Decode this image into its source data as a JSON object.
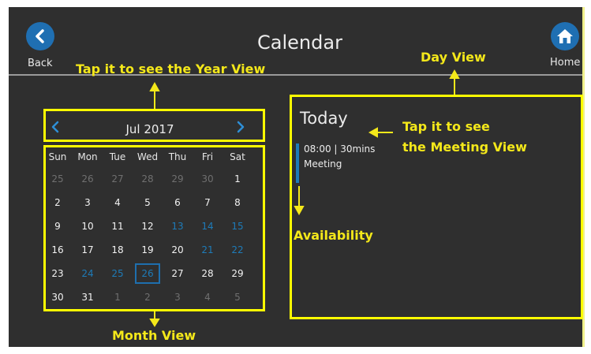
{
  "header": {
    "title": "Calendar",
    "back_label": "Back",
    "home_label": "Home"
  },
  "month_view": {
    "month_label": "Jul 2017",
    "weekdays": [
      "Sun",
      "Mon",
      "Tue",
      "Wed",
      "Thu",
      "Fri",
      "Sat"
    ],
    "weeks": [
      [
        {
          "d": "25",
          "s": "other"
        },
        {
          "d": "26",
          "s": "other"
        },
        {
          "d": "27",
          "s": "other"
        },
        {
          "d": "28",
          "s": "other"
        },
        {
          "d": "29",
          "s": "other"
        },
        {
          "d": "30",
          "s": "other"
        },
        {
          "d": "1",
          "s": ""
        }
      ],
      [
        {
          "d": "2",
          "s": ""
        },
        {
          "d": "3",
          "s": ""
        },
        {
          "d": "4",
          "s": ""
        },
        {
          "d": "5",
          "s": ""
        },
        {
          "d": "6",
          "s": ""
        },
        {
          "d": "7",
          "s": ""
        },
        {
          "d": "8",
          "s": ""
        }
      ],
      [
        {
          "d": "9",
          "s": ""
        },
        {
          "d": "10",
          "s": ""
        },
        {
          "d": "11",
          "s": ""
        },
        {
          "d": "12",
          "s": ""
        },
        {
          "d": "13",
          "s": "blue"
        },
        {
          "d": "14",
          "s": "blue"
        },
        {
          "d": "15",
          "s": "blue"
        }
      ],
      [
        {
          "d": "16",
          "s": ""
        },
        {
          "d": "17",
          "s": ""
        },
        {
          "d": "18",
          "s": ""
        },
        {
          "d": "19",
          "s": ""
        },
        {
          "d": "20",
          "s": ""
        },
        {
          "d": "21",
          "s": "blue"
        },
        {
          "d": "22",
          "s": "blue"
        }
      ],
      [
        {
          "d": "23",
          "s": ""
        },
        {
          "d": "24",
          "s": "blue"
        },
        {
          "d": "25",
          "s": "blue"
        },
        {
          "d": "26",
          "s": "sel"
        },
        {
          "d": "27",
          "s": ""
        },
        {
          "d": "28",
          "s": ""
        },
        {
          "d": "29",
          "s": ""
        }
      ],
      [
        {
          "d": "30",
          "s": ""
        },
        {
          "d": "31",
          "s": ""
        },
        {
          "d": "1",
          "s": "other"
        },
        {
          "d": "2",
          "s": "other"
        },
        {
          "d": "3",
          "s": "other"
        },
        {
          "d": "4",
          "s": "other"
        },
        {
          "d": "5",
          "s": "other"
        }
      ]
    ]
  },
  "day_view": {
    "today_label": "Today",
    "meeting": {
      "time": "08:00 | 30mins",
      "title": "Meeting"
    }
  },
  "annotations": {
    "year_view": "Tap it to see the Year View",
    "day_view": "Day View",
    "meeting_view_1": "Tap it to see",
    "meeting_view_2": "the Meeting View",
    "availability": "Availability",
    "month_view": "Month View"
  },
  "colors": {
    "screen_bg": "#2f2f2f",
    "accent_blue": "#1e7bb8",
    "annotation_yellow": "#f4e81a"
  }
}
